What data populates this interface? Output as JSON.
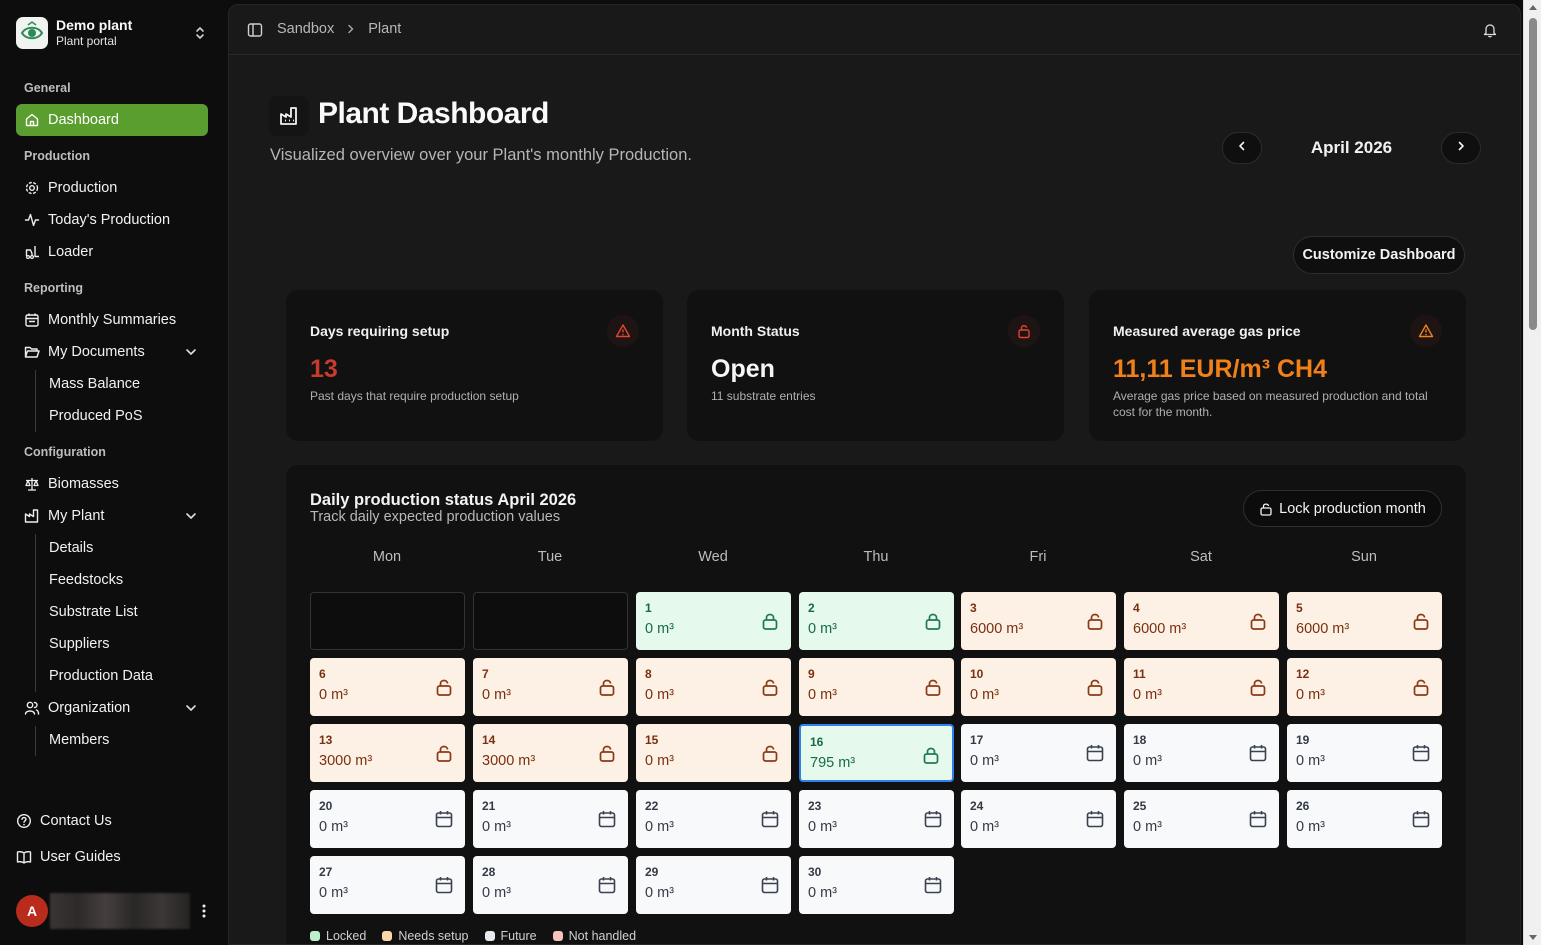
{
  "app": {
    "name": "Demo plant",
    "subtitle": "Plant portal"
  },
  "sidebar": {
    "groups": {
      "general": "General",
      "production": "Production",
      "reporting": "Reporting",
      "configuration": "Configuration"
    },
    "items": {
      "dashboard": "Dashboard",
      "production": "Production",
      "todays_production": "Today's Production",
      "loader": "Loader",
      "monthly_summaries": "Monthly Summaries",
      "my_documents": "My Documents",
      "mass_balance": "Mass Balance",
      "produced_pos": "Produced PoS",
      "biomasses": "Biomasses",
      "my_plant": "My Plant",
      "details": "Details",
      "feedstocks": "Feedstocks",
      "substrate_list": "Substrate List",
      "suppliers": "Suppliers",
      "production_data": "Production Data",
      "organization": "Organization",
      "members": "Members"
    },
    "footer": {
      "contact": "Contact Us",
      "guides": "User Guides"
    },
    "user": {
      "initial": "A"
    }
  },
  "breadcrumb": [
    "Sandbox",
    "Plant"
  ],
  "page": {
    "title": "Plant Dashboard",
    "subtitle": "Visualized overview over your Plant's monthly Production.",
    "month": "April 2026",
    "customize_label": "Customize Dashboard"
  },
  "cards": [
    {
      "title": "Days requiring setup",
      "value": "13",
      "desc": "Past days that require production setup",
      "value_color": "#c9392d",
      "icon": "alert-triangle-icon"
    },
    {
      "title": "Month Status",
      "value": "Open",
      "desc": "11 substrate entries",
      "value_color": "#f5f5f5",
      "icon": "lock-open-icon"
    },
    {
      "title": "Measured average gas price",
      "value": "11,11 EUR/m³ CH4",
      "desc": "Average gas price based on measured production and total cost for the month.",
      "value_color": "#f0801a",
      "icon": "alert-triangle-icon"
    }
  ],
  "calendar": {
    "title": "Daily production status April 2026",
    "subtitle": "Track daily expected production values",
    "lock_label": "Lock production month",
    "weekdays": [
      "Mon",
      "Tue",
      "Wed",
      "Thu",
      "Fri",
      "Sat",
      "Sun"
    ],
    "days": [
      {
        "day": "1",
        "value": "0 m³",
        "status": "locked"
      },
      {
        "day": "2",
        "value": "0 m³",
        "status": "locked"
      },
      {
        "day": "3",
        "value": "6000 m³",
        "status": "setup"
      },
      {
        "day": "4",
        "value": "6000 m³",
        "status": "setup"
      },
      {
        "day": "5",
        "value": "6000 m³",
        "status": "setup"
      },
      {
        "day": "6",
        "value": "0 m³",
        "status": "setup"
      },
      {
        "day": "7",
        "value": "0 m³",
        "status": "setup"
      },
      {
        "day": "8",
        "value": "0 m³",
        "status": "setup"
      },
      {
        "day": "9",
        "value": "0 m³",
        "status": "setup"
      },
      {
        "day": "10",
        "value": "0 m³",
        "status": "setup"
      },
      {
        "day": "11",
        "value": "0 m³",
        "status": "setup"
      },
      {
        "day": "12",
        "value": "0 m³",
        "status": "setup"
      },
      {
        "day": "13",
        "value": "3000 m³",
        "status": "setup"
      },
      {
        "day": "14",
        "value": "3000 m³",
        "status": "setup"
      },
      {
        "day": "15",
        "value": "0 m³",
        "status": "setup"
      },
      {
        "day": "16",
        "value": "795 m³",
        "status": "locked",
        "selected": true
      },
      {
        "day": "17",
        "value": "0 m³",
        "status": "future"
      },
      {
        "day": "18",
        "value": "0 m³",
        "status": "future"
      },
      {
        "day": "19",
        "value": "0 m³",
        "status": "future"
      },
      {
        "day": "20",
        "value": "0 m³",
        "status": "future"
      },
      {
        "day": "21",
        "value": "0 m³",
        "status": "future"
      },
      {
        "day": "22",
        "value": "0 m³",
        "status": "future"
      },
      {
        "day": "23",
        "value": "0 m³",
        "status": "future"
      },
      {
        "day": "24",
        "value": "0 m³",
        "status": "future"
      },
      {
        "day": "25",
        "value": "0 m³",
        "status": "future"
      },
      {
        "day": "26",
        "value": "0 m³",
        "status": "future"
      },
      {
        "day": "27",
        "value": "0 m³",
        "status": "future"
      },
      {
        "day": "28",
        "value": "0 m³",
        "status": "future"
      },
      {
        "day": "29",
        "value": "0 m³",
        "status": "future"
      },
      {
        "day": "30",
        "value": "0 m³",
        "status": "future"
      }
    ],
    "legend": [
      {
        "label": "Locked",
        "color": "#bfeecf"
      },
      {
        "label": "Needs setup",
        "color": "#fbd8a8"
      },
      {
        "label": "Future",
        "color": "#e6e9ee"
      },
      {
        "label": "Not handled",
        "color": "#f8c3bd"
      }
    ]
  },
  "colors": {
    "accent": "#5a9e2f"
  }
}
